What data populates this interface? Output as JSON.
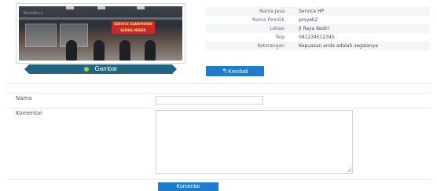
{
  "profile": {
    "photo_caption": "Gambar",
    "photo_sign_text": "SERVICE HANDPHONE SEMUA MEREK",
    "photo_brand_text": "BlackBerry"
  },
  "details": [
    {
      "label": "Nama Jasa",
      "value": "Service HP"
    },
    {
      "label": "Nama Pemilik",
      "value": "proyek2"
    },
    {
      "label": "Lokasi",
      "value": "Jl Raya Kediri"
    },
    {
      "label": "Telp",
      "value": "081234512345"
    },
    {
      "label": "Keterangan",
      "value": "Kepuasan anda adalah segalanya"
    }
  ],
  "actions": {
    "back_label": "Kembali",
    "back_icon": "reply-arrow-icon"
  },
  "form": {
    "name_label": "Nama",
    "name_value": "",
    "comment_label": "Komentar",
    "comment_value": "",
    "submit_label": "Komentar"
  },
  "colors": {
    "accent": "#1f7bcb",
    "ribbon": "#23657f",
    "dot": "#9bd33c"
  }
}
